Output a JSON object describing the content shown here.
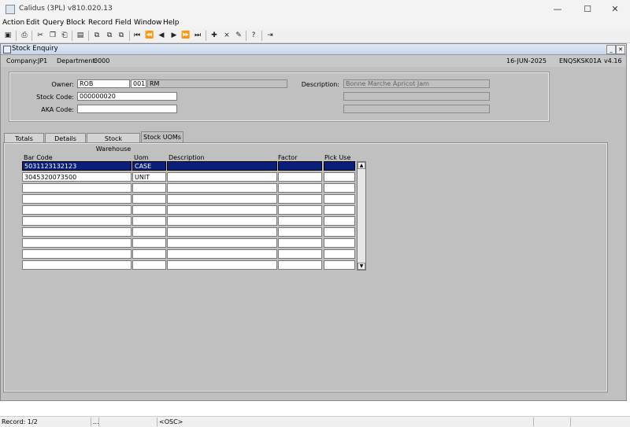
{
  "window": {
    "title": "Calidus (3PL) v810.020.13",
    "minimize": "—",
    "maximize": "☐",
    "close": "✕"
  },
  "menu": [
    "Action",
    "Edit",
    "Query",
    "Block",
    "Record",
    "Field",
    "Window",
    "Help"
  ],
  "toolbar_icons": [
    "save-icon",
    "print-icon",
    "cut-icon",
    "copy-icon",
    "paste-icon",
    "clear-icon",
    "query-icon",
    "execute-query-icon",
    "cancel-query-icon",
    "first-record-icon",
    "previous-block-icon",
    "previous-record-icon",
    "next-record-icon",
    "next-block-icon",
    "last-record-icon",
    "insert-record-icon",
    "delete-record-icon",
    "clear-record-icon",
    "help-icon",
    "exit-icon"
  ],
  "form": {
    "title": "Stock Enquiry",
    "company_label": "Company:",
    "company": "JP1",
    "department_label": "Department:",
    "department": "0000",
    "date": "16-JUN-2025",
    "form_code": "ENQSKSK01A",
    "version": "v4.16"
  },
  "header": {
    "owner_label": "Owner:",
    "owner": "ROB",
    "owner_num": "001",
    "owner_name": "RM",
    "stock_code_label": "Stock Code:",
    "stock_code": "000000020",
    "aka_code_label": "AKA Code:",
    "aka_code": "",
    "description_label": "Description:",
    "description": "Bonne Marche Apricot Jam",
    "description2": "",
    "description3": ""
  },
  "tabs": [
    "Totals",
    "Details",
    "Stock Warehouse",
    "Stock UOMs"
  ],
  "active_tab": "Stock UOMs",
  "uom_table": {
    "columns": [
      "Bar Code",
      "Uom",
      "Description",
      "Factor",
      "Pick Use"
    ],
    "rows": [
      [
        "5031123132123",
        "CASE",
        "",
        "",
        ""
      ],
      [
        "3045320073500",
        "UNIT",
        "",
        "",
        ""
      ],
      [
        "",
        "",
        "",
        "",
        ""
      ],
      [
        "",
        "",
        "",
        "",
        ""
      ],
      [
        "",
        "",
        "",
        "",
        ""
      ],
      [
        "",
        "",
        "",
        "",
        ""
      ],
      [
        "",
        "",
        "",
        "",
        ""
      ],
      [
        "",
        "",
        "",
        "",
        ""
      ],
      [
        "",
        "",
        "",
        "",
        ""
      ],
      [
        "",
        "",
        "",
        "",
        ""
      ]
    ]
  },
  "status": {
    "record": "Record: 1/2",
    "ellipsis": "...",
    "osc": "<OSC>"
  },
  "colors": {
    "selected_row": "#0a1f7a",
    "form_background": "#c0c0c0"
  }
}
